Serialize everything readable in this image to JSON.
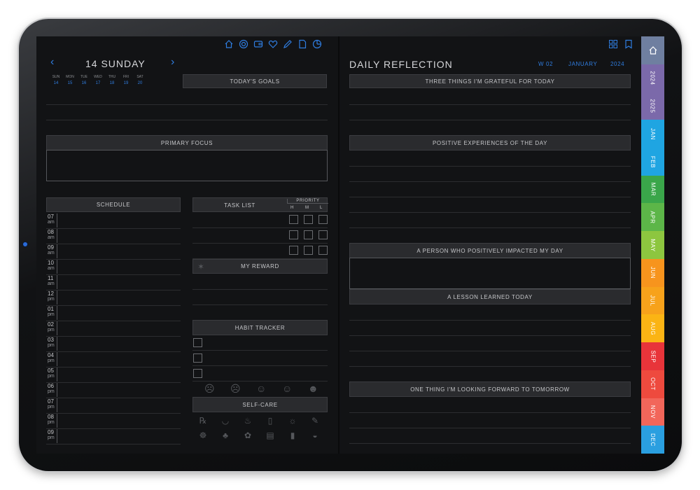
{
  "nav_icons": [
    "home-icon",
    "target-icon",
    "wallet-icon",
    "heart-icon",
    "pen-icon",
    "document-icon",
    "pie-chart-icon"
  ],
  "right_icons": [
    "grid-icon",
    "bookmark-icon"
  ],
  "date": {
    "prev": "‹",
    "title": "14 SUNDAY",
    "next": "›"
  },
  "week": {
    "days": [
      "SUN",
      "MON",
      "TUE",
      "WED",
      "THU",
      "FRI",
      "SAT"
    ],
    "dates": [
      "14",
      "15",
      "16",
      "17",
      "18",
      "19",
      "20"
    ]
  },
  "left": {
    "todays_goals": "TODAY'S GOALS",
    "primary_focus": "PRIMARY FOCUS",
    "schedule": "SCHEDULE",
    "task_list": "TASK LIST",
    "priority": "PRIORITY",
    "priority_levels": [
      "H",
      "M",
      "L"
    ],
    "my_reward": "MY REWARD",
    "habit_tracker": "HABIT TRACKER",
    "self_care": "SELF-CARE",
    "hours": [
      {
        "h": "07",
        "p": "am"
      },
      {
        "h": "08",
        "p": "am"
      },
      {
        "h": "09",
        "p": "am"
      },
      {
        "h": "10",
        "p": "am"
      },
      {
        "h": "11",
        "p": "am"
      },
      {
        "h": "12",
        "p": "pm"
      },
      {
        "h": "01",
        "p": "pm"
      },
      {
        "h": "02",
        "p": "pm"
      },
      {
        "h": "03",
        "p": "pm"
      },
      {
        "h": "04",
        "p": "pm"
      },
      {
        "h": "05",
        "p": "pm"
      },
      {
        "h": "06",
        "p": "pm"
      },
      {
        "h": "07",
        "p": "pm"
      },
      {
        "h": "08",
        "p": "pm"
      },
      {
        "h": "09",
        "p": "pm"
      }
    ],
    "mood_icons": [
      "mood-1-icon",
      "mood-2-icon",
      "mood-3-icon",
      "mood-4-icon",
      "mood-5-icon"
    ],
    "selfcare_icons": [
      "pills-icon",
      "tooth-icon",
      "bath-icon",
      "water-icon",
      "sun-icon",
      "broom-icon",
      "meditate-icon",
      "pet-icon",
      "brain-icon",
      "journal-icon",
      "phone-icon",
      "food-bowl-icon"
    ]
  },
  "right": {
    "title": "DAILY REFLECTION",
    "week": "W 02",
    "month": "JANUARY",
    "year": "2024",
    "grateful": "THREE THINGS I'M GRATEFUL FOR TODAY",
    "positive": "POSITIVE EXPERIENCES OF THE DAY",
    "person": "A PERSON WHO POSITIVELY IMPACTED MY DAY",
    "lesson": "A LESSON LEARNED TODAY",
    "forward": "ONE THING I'M LOOKING FORWARD TO TOMORROW"
  },
  "tabs": [
    {
      "label": "",
      "color": "#6f7fa0",
      "icon": "home-icon"
    },
    {
      "label": "2024",
      "color": "#7b69aa"
    },
    {
      "label": "2025",
      "color": "#7b69aa"
    },
    {
      "label": "JAN",
      "color": "#1fa5e2"
    },
    {
      "label": "FEB",
      "color": "#1fa5e2"
    },
    {
      "label": "MAR",
      "color": "#3aa64a"
    },
    {
      "label": "APR",
      "color": "#5cb648"
    },
    {
      "label": "MAY",
      "color": "#8dc63f"
    },
    {
      "label": "JUN",
      "color": "#f7941d"
    },
    {
      "label": "JUL",
      "color": "#f7a21b"
    },
    {
      "label": "AUG",
      "color": "#fbb414"
    },
    {
      "label": "SEP",
      "color": "#e8343a"
    },
    {
      "label": "OCT",
      "color": "#ee4a3e"
    },
    {
      "label": "NOV",
      "color": "#f2665a"
    },
    {
      "label": "DEC",
      "color": "#2a9fe0"
    }
  ]
}
